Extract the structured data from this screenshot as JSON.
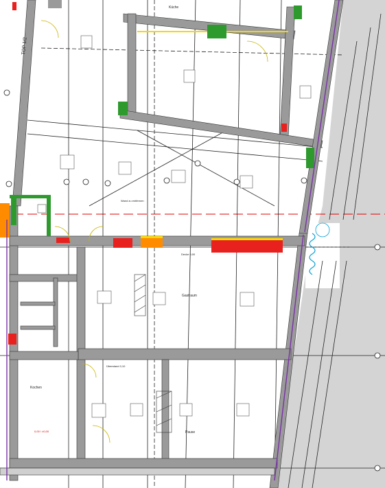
{
  "drawing": {
    "top_label": "TOP 1/2",
    "rooms": [
      {
        "id": "room-top-right",
        "name": "Küche"
      },
      {
        "id": "room-mid",
        "name": "Gastraum"
      },
      {
        "id": "room-bottom-left",
        "name": "Kochen"
      },
      {
        "id": "room-bottom-right",
        "name": "Pause"
      }
    ],
    "notes": {
      "diagonal_note": "Wand zu entfernen",
      "opening_note": "Decke 0,00",
      "beam_note": "Überstand 0,10",
      "level_note": "0,00 / ±0,00"
    }
  },
  "colors": {
    "wall": "#9a9a9a",
    "outside": "#d4d4d4",
    "fire_red": "#e8201e",
    "green": "#2e9a2e",
    "orange": "#ff8c00",
    "yellow": "#f5d800",
    "purple": "#7a2fa8",
    "cyan": "#00a0d8",
    "red_line": "#e00000"
  }
}
